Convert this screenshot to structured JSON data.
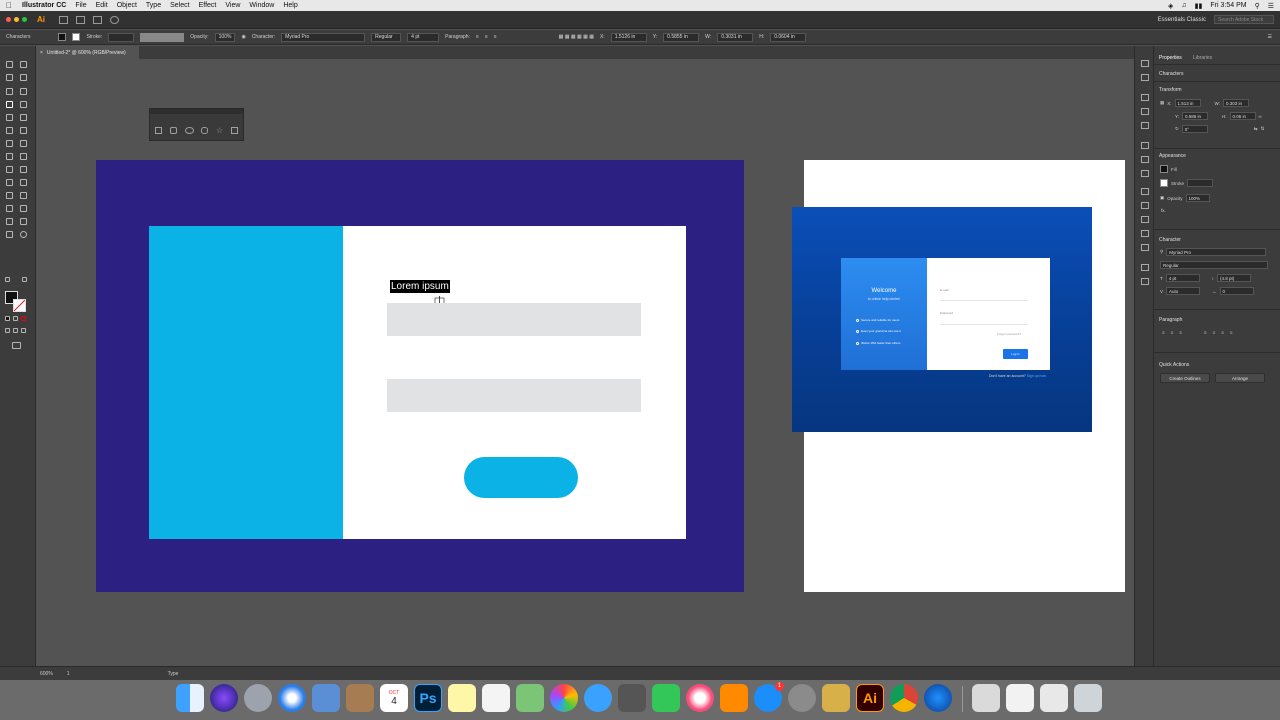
{
  "menubar": {
    "app": "Illustrator CC",
    "items": [
      "File",
      "Edit",
      "Object",
      "Type",
      "Select",
      "Effect",
      "View",
      "Window",
      "Help"
    ],
    "time": "Fri 3:54 PM"
  },
  "appbar": {
    "logo": "Ai",
    "workspace": "Essentials Classic",
    "stock_search_placeholder": "Search Adobe Stock"
  },
  "controlbar": {
    "panel_label": "Characters",
    "stroke_label": "Stroke:",
    "opacity_label": "Opacity:",
    "opacity_value": "100%",
    "character_label": "Character:",
    "font_family": "Myriad Pro",
    "font_style": "Regular",
    "font_size": "4 pt",
    "paragraph_label": "Paragraph:",
    "x_label": "X:",
    "x_value": "1.5126 in",
    "y_label": "Y:",
    "y_value": "0.5855 in",
    "w_label": "W:",
    "w_value": "0.3031 in",
    "h_label": "H:",
    "h_value": "0.0604 in"
  },
  "document": {
    "tab_title": "Untitled-2* @ 600% (RGB/Preview)"
  },
  "artboard1": {
    "lorem_text": "Lorem ipsum",
    "colors": {
      "background": "#2c2182",
      "accent": "#0bb2e6",
      "field": "#e1e2e4"
    }
  },
  "artboard2": {
    "welcome_title": "Welcome",
    "welcome_sub": "to online help center!",
    "features": [
      "Secure and reliable for users",
      "Even your grandma can use it",
      "Works 15% faster than others"
    ],
    "email_label": "E-mail",
    "password_label": "Password",
    "forgot_label": "Forgot password?",
    "login_button": "Log in",
    "signup_text": "Don't have an account?",
    "signup_link": "Sign up now"
  },
  "properties_panel": {
    "tabs": [
      "Properties",
      "Libraries"
    ],
    "object_type": "Characters",
    "transform_label": "Transform",
    "x_label": "X:",
    "x_value": "1.513 in",
    "y_label": "Y:",
    "y_value": "0.586 in",
    "w_label": "W:",
    "w_value": "0.303 in",
    "h_label": "H:",
    "h_value": "0.06 in",
    "rotation_value": "0°",
    "appearance_label": "Appearance",
    "fill_label": "Fill",
    "stroke_label": "Stroke",
    "opacity_label": "Opacity",
    "opacity_value": "100%",
    "fx_label": "fx.",
    "character_label": "Character",
    "font_family": "Myriad Pro",
    "font_style": "Regular",
    "font_size": "4 pt",
    "leading_value": "(4.8 pt)",
    "kerning_value": "Auto",
    "tracking_value": "0",
    "paragraph_label": "Paragraph",
    "quick_actions_label": "Quick Actions",
    "create_outlines_button": "Create Outlines",
    "arrange_button": "Arrange"
  },
  "statusbar": {
    "zoom": "600%",
    "artboard_number": "1",
    "tool": "Type"
  },
  "dock": {
    "calendar_month": "OCT",
    "calendar_day": "4",
    "photoshop_label": "Ps",
    "illustrator_label": "Ai",
    "appstore_badge": "1"
  }
}
